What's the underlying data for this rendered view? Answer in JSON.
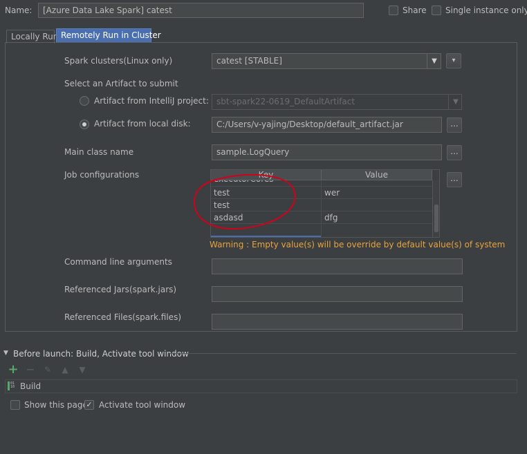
{
  "header": {
    "name_label": "Name:",
    "name_value": "[Azure Data Lake Spark] catest",
    "share_label": "Share",
    "single_instance_label": "Single instance only"
  },
  "tabs": [
    {
      "label": "Locally Run"
    },
    {
      "label": "Remotely Run in Cluster"
    }
  ],
  "cluster": {
    "label": "Spark clusters(Linux only)",
    "selected": "catest [STABLE]"
  },
  "artifact": {
    "section_label": "Select an Artifact to submit",
    "from_project_label": "Artifact from IntelliJ project:",
    "project_value": "sbt-spark22-0619_DefaultArtifact",
    "from_disk_label": "Artifact from local disk:",
    "disk_value": "C:/Users/v-yajing/Desktop/default_artifact.jar",
    "dots": "..."
  },
  "main_class": {
    "label": "Main class name",
    "value": "sample.LogQuery"
  },
  "job_config": {
    "label": "Job configurations",
    "key_header": "Key",
    "value_header": "Value",
    "partial_row_key": "executorCores",
    "rows": [
      {
        "key": "test",
        "value": "wer"
      },
      {
        "key": "test",
        "value": ""
      },
      {
        "key": "asdasd",
        "value": "dfg"
      }
    ],
    "warning": "Warning : Empty value(s) will be override by default value(s) of system",
    "annotation_color": "#d0021b"
  },
  "args": {
    "cmd_label": "Command line arguments",
    "jars_label": "Referenced Jars(spark.jars)",
    "files_label": "Referenced Files(spark.files)"
  },
  "before_launch": {
    "title": "Before launch: Build, Activate tool window",
    "build_item": "Build",
    "show_page_label": "Show this page",
    "activate_label": "Activate tool window"
  },
  "colors": {
    "accent": "#4b6eaf",
    "warning": "#e8a33d",
    "add": "#59a869"
  }
}
